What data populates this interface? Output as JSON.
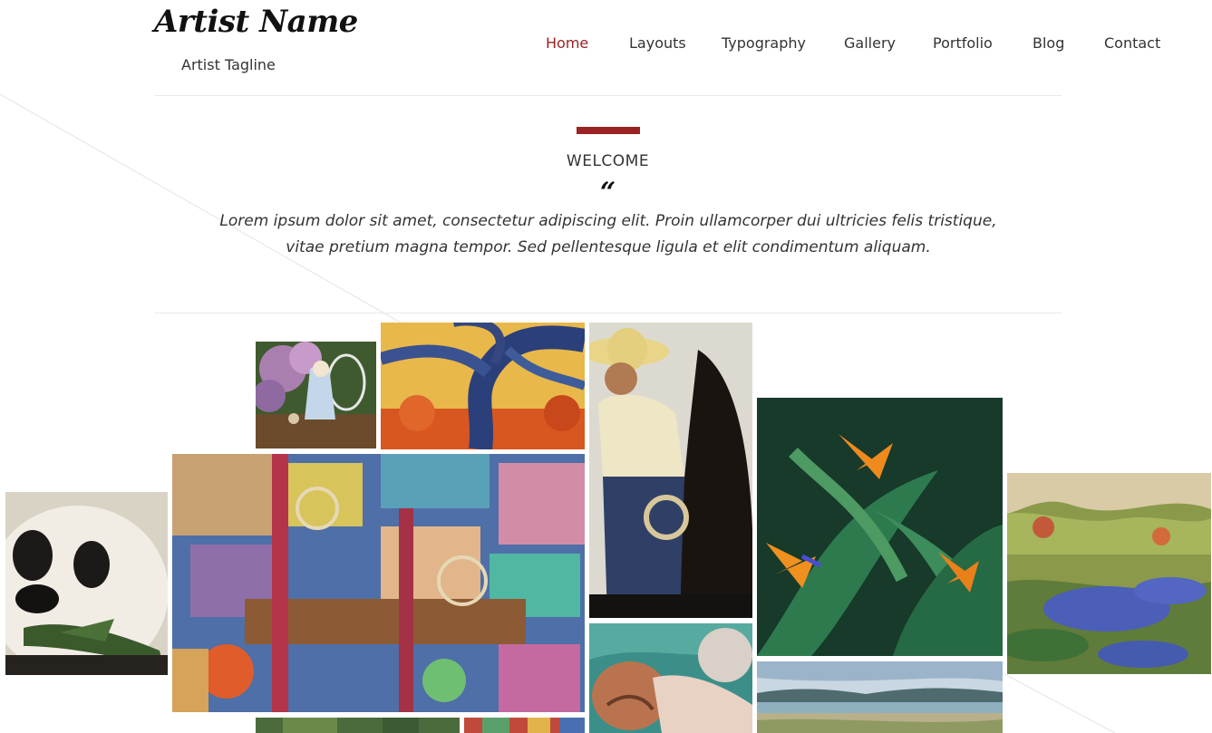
{
  "header": {
    "artist_name": "Artist Name",
    "tagline": "Artist Tagline"
  },
  "nav": {
    "items": [
      "Home",
      "Layouts",
      "Typography",
      "Gallery",
      "Portfolio",
      "Blog",
      "Contact"
    ],
    "active": "Home"
  },
  "welcome": {
    "title": "WELCOME",
    "quote_mark": "“",
    "text_line1": "Lorem ipsum dolor sit amet, consectetur adipiscing elit. Proin ullamcorper dui ultricies felis tristique,",
    "text_line2": "vitae pretium magna tempor. Sed pellentesque ligula et elit condimentum aliquam."
  },
  "colors": {
    "accent": "#9b2222",
    "text": "#333333",
    "rule": "#e9e9e9"
  },
  "gallery": {
    "artworks": [
      "child-in-garden-painting",
      "blue-tree-painting",
      "horseman-painting",
      "bird-of-paradise-painting",
      "panda-painting",
      "abstract-mural-painting",
      "meadow-landscape-painting",
      "swimmer-painting",
      "coastal-landscape-painting",
      "garden-painting-bottom",
      "abstract-painting-bottom"
    ]
  }
}
